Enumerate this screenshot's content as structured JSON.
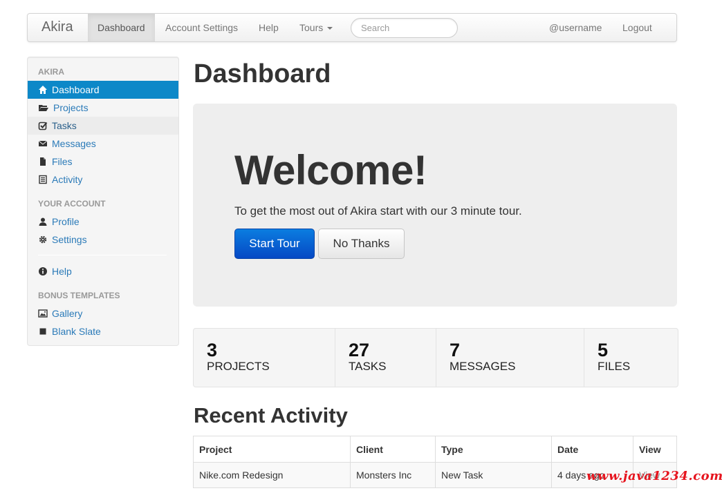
{
  "navbar": {
    "brand": "Akira",
    "items": [
      {
        "label": "Dashboard",
        "active": true
      },
      {
        "label": "Account Settings"
      },
      {
        "label": "Help"
      },
      {
        "label": "Tours",
        "dropdown": true
      }
    ],
    "search_placeholder": "Search",
    "username": "@username",
    "logout": "Logout"
  },
  "sidebar": {
    "sections": [
      {
        "header": "AKIRA",
        "items": [
          {
            "label": "Dashboard",
            "icon": "home-icon",
            "active": true
          },
          {
            "label": "Projects",
            "icon": "folder-open-icon"
          },
          {
            "label": "Tasks",
            "icon": "check-square-icon",
            "hover": true
          },
          {
            "label": "Messages",
            "icon": "envelope-icon"
          },
          {
            "label": "Files",
            "icon": "file-icon"
          },
          {
            "label": "Activity",
            "icon": "list-icon"
          }
        ]
      },
      {
        "header": "YOUR ACCOUNT",
        "items": [
          {
            "label": "Profile",
            "icon": "user-icon"
          },
          {
            "label": "Settings",
            "icon": "gear-icon"
          }
        ]
      },
      {
        "header": "",
        "items": [
          {
            "label": "Help",
            "icon": "info-circle-icon"
          }
        ]
      },
      {
        "header": "BONUS TEMPLATES",
        "items": [
          {
            "label": "Gallery",
            "icon": "picture-icon"
          },
          {
            "label": "Blank Slate",
            "icon": "square-icon"
          }
        ]
      }
    ]
  },
  "main": {
    "title": "Dashboard",
    "hero": {
      "title": "Welcome!",
      "text": "To get the most out of Akira start with our 3 minute tour.",
      "primary_button": "Start Tour",
      "secondary_button": "No Thanks"
    },
    "stats": [
      {
        "value": "3",
        "label": "PROJECTS"
      },
      {
        "value": "27",
        "label": "TASKS"
      },
      {
        "value": "7",
        "label": "MESSAGES"
      },
      {
        "value": "5",
        "label": "FILES"
      }
    ],
    "recent_activity": {
      "title": "Recent Activity",
      "columns": [
        "Project",
        "Client",
        "Type",
        "Date",
        "View"
      ],
      "rows": [
        [
          "Nike.com Redesign",
          "Monsters Inc",
          "New Task",
          "4 days ago",
          "View"
        ]
      ]
    }
  },
  "watermark": "www.java1234.com",
  "colors": {
    "accent": "#0d88c8",
    "link": "#2a7ab8",
    "primary_button": "#0548c4",
    "watermark": "#e6141e"
  }
}
